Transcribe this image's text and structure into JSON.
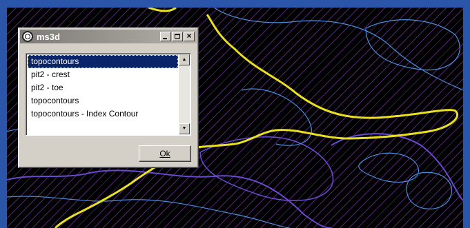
{
  "window": {
    "title": "ms3d",
    "minimize_label": "_",
    "close_label": "×"
  },
  "list": {
    "items": [
      "topocontours",
      "pit2 - crest",
      "pit2 - toe",
      "topocontours",
      "topocontours - Index Contour"
    ],
    "selected_index": 0
  },
  "buttons": {
    "ok_label": "Ok"
  },
  "colors": {
    "desktop": "#2a55a8",
    "viewport_background": "#000000",
    "hatch_lines": "#9646d2",
    "contour_major": "#e8e020",
    "contour_minor_blue": "#4a8fe0",
    "contour_minor_purple": "#6a4ad0",
    "selection": "#0a246a"
  },
  "icons": {
    "app": "ms3d-app-icon",
    "minimize": "minimize-icon",
    "maximize": "maximize-icon",
    "close": "close-icon",
    "scroll_up": "scroll-up-arrow-icon",
    "scroll_down": "scroll-down-arrow-icon"
  }
}
